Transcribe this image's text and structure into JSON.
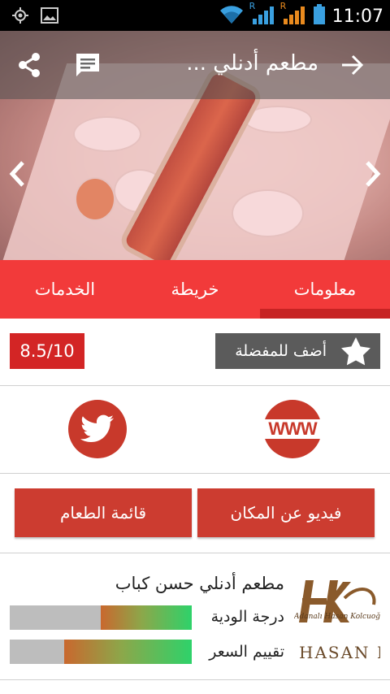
{
  "status_bar": {
    "time": "11:07",
    "left_icons": [
      "gps-icon",
      "image-icon"
    ],
    "right_icons": [
      "wifi-icon",
      "signal-r-icon",
      "signal-r2-icon",
      "battery-icon"
    ],
    "signal_letters": [
      "R",
      "R"
    ]
  },
  "header": {
    "title": "مطعم أدنلي ...",
    "icons": [
      "back-arrow-icon",
      "comment-icon",
      "share-icon"
    ]
  },
  "hero": {
    "nav_icons": [
      "chevron-left-icon",
      "chevron-right-icon"
    ]
  },
  "tabs": [
    {
      "label": "معلومات",
      "active": true
    },
    {
      "label": "خريطة",
      "active": false
    },
    {
      "label": "الخدمات",
      "active": false
    }
  ],
  "info": {
    "score": "8.5/10",
    "favorite_label": "أضف للمفضلة"
  },
  "links": {
    "www_label": "WWW",
    "icons": [
      "www-icon",
      "twitter-icon"
    ]
  },
  "buttons": {
    "video_label": "فيديو عن المكان",
    "menu_label": "قائمة الطعام"
  },
  "restaurant": {
    "name": "مطعم أدنلي حسن كباب",
    "logo_text": "HASAN KO",
    "logo_script": "Adanalı Hasan Kolcuoğlu",
    "metrics": [
      {
        "label": "درجة الودية",
        "fill": 0.5
      },
      {
        "label": "تقييم السعر",
        "fill": 0.7
      }
    ]
  },
  "colors": {
    "tab_bar": "#f23a3a",
    "tab_indicator": "#c72323",
    "button": "#cc3c30",
    "score_badge": "#d32525",
    "favorite_bg": "#5b5b5b",
    "status_accent": "#3aa0e0"
  }
}
